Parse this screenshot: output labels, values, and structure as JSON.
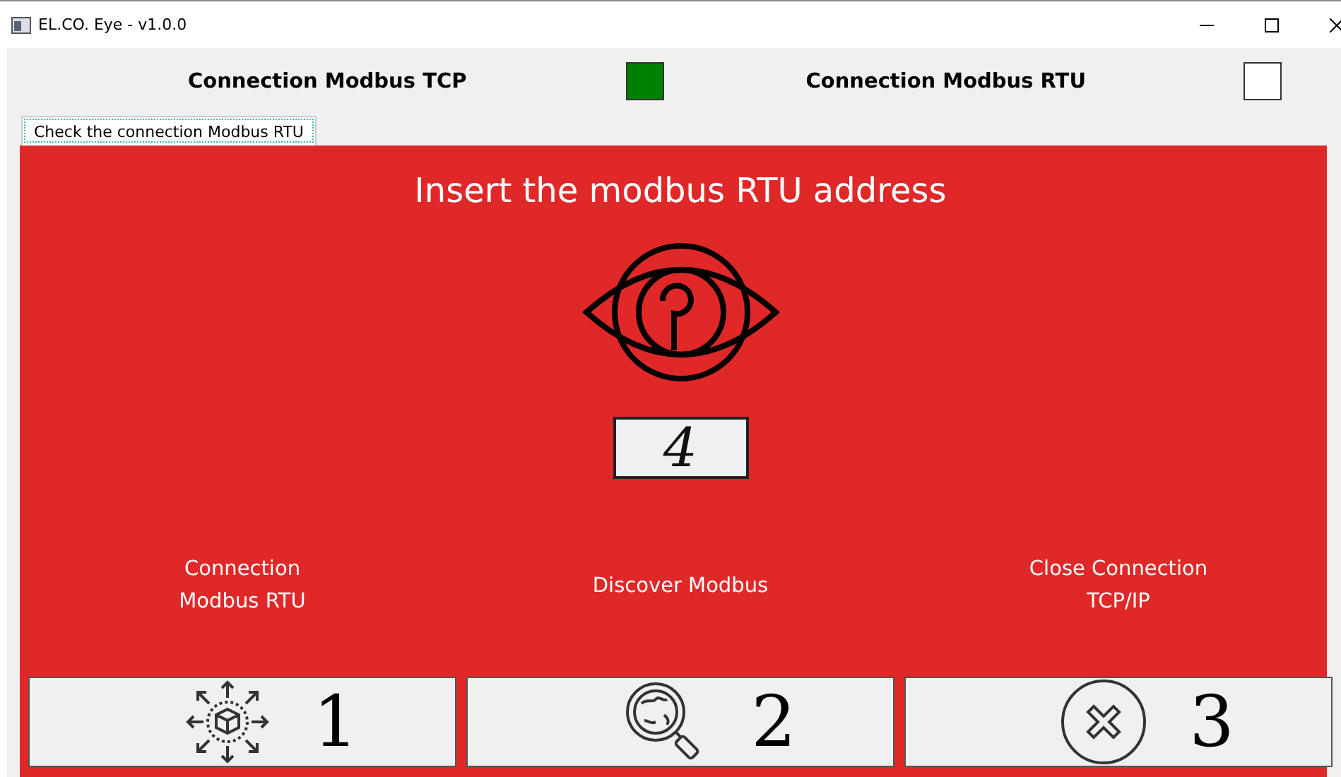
{
  "window": {
    "title": "EL.CO. Eye - v1.0.0"
  },
  "header": [
    {
      "label": "Connection Modbus TCP",
      "on": true
    },
    {
      "label": "Connection Modbus RTU",
      "on": false
    }
  ],
  "tabs": [
    {
      "label": "Check the connection Modbus RTU",
      "selected": true
    }
  ],
  "panel": {
    "heading": "Insert the modbus RTU address",
    "address": "4",
    "actions": [
      {
        "label": "Connection\nModbus RTU",
        "kind": "connect",
        "digit": "1"
      },
      {
        "label": "Discover Modbus",
        "kind": "discover",
        "digit": "2"
      },
      {
        "label": "Close Connection\nTCP/IP",
        "kind": "close",
        "digit": "3"
      }
    ]
  }
}
